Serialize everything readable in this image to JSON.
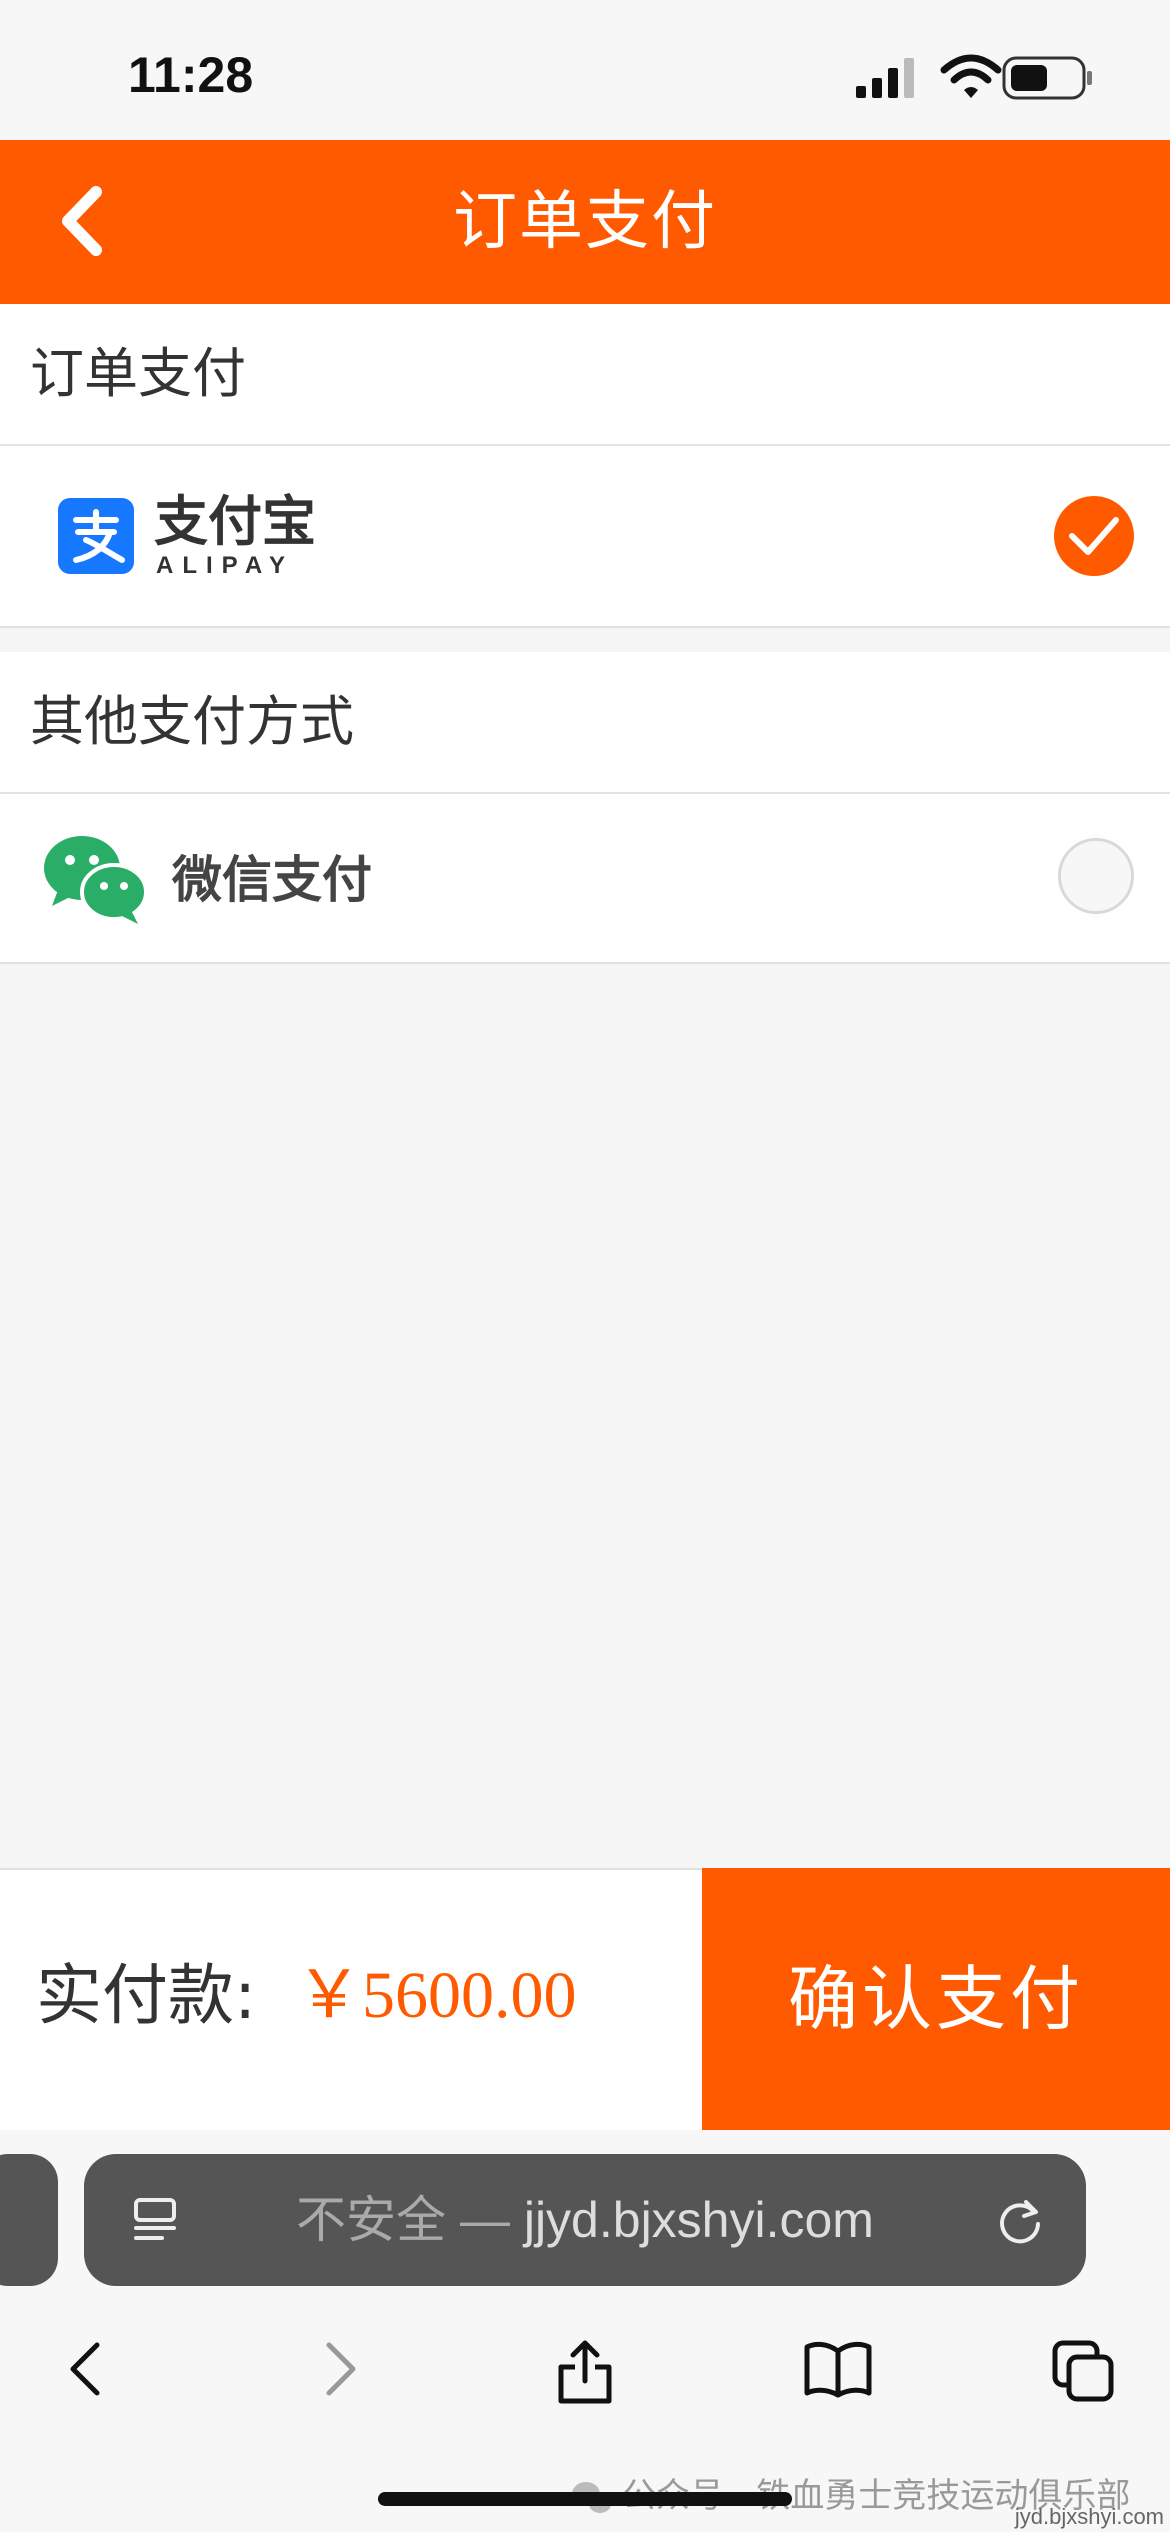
{
  "status_bar": {
    "time": "11:28"
  },
  "nav": {
    "title": "订单支付"
  },
  "sections": {
    "primary_header": "订单支付",
    "other_header": "其他支付方式"
  },
  "payment_methods": {
    "alipay": {
      "name": "支付宝",
      "sub": "ALIPAY",
      "selected": true
    },
    "wechat": {
      "name": "微信支付",
      "selected": false
    }
  },
  "order": {
    "total_label": "实付款:",
    "total_amount": "￥5600.00",
    "confirm_label": "确认支付"
  },
  "browser": {
    "security_text": "不安全 — ",
    "url": "jjyd.bjxshyi.com"
  },
  "watermark": {
    "text": "公众号 · 铁血勇士竞技运动俱乐部"
  },
  "footer_site": "jyd.bjxshyi.com",
  "colors": {
    "accent": "#ff5a00",
    "alipay": "#1677ff",
    "wechat": "#2aae67"
  }
}
